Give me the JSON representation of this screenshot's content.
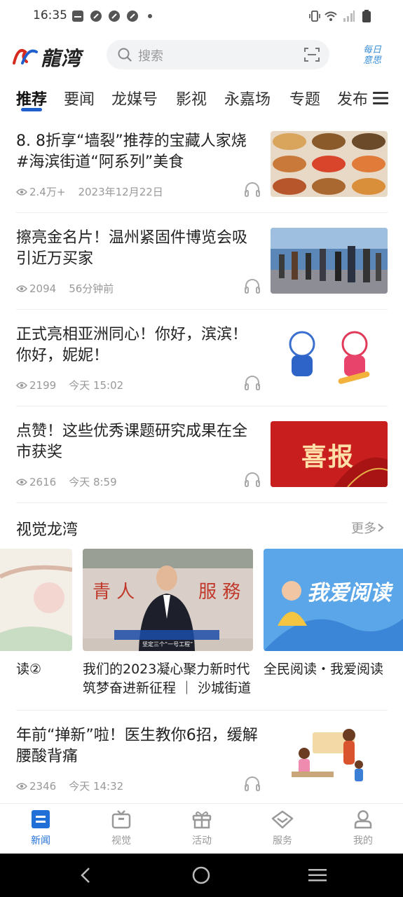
{
  "status_bar": {
    "time": "16:35"
  },
  "header": {
    "logo_text": "龍湾",
    "search_placeholder": "搜索",
    "daily_brief_line1": "每日",
    "daily_brief_line2": "意思"
  },
  "tabs": [
    {
      "label": "推荐"
    },
    {
      "label": "要闻"
    },
    {
      "label": "龙媒号"
    },
    {
      "label": "影视"
    },
    {
      "label": "永嘉场"
    },
    {
      "label": "专题"
    },
    {
      "label": "发布"
    }
  ],
  "news": [
    {
      "title": "8. 8折享“墙裂”推荐的宝藏人家烧　#海滨街道“阿系列”美食",
      "views": "2.4万+",
      "time": "2023年12月22日"
    },
    {
      "title": "擦亮金名片！温州紧固件博览会吸引近万买家",
      "views": "2094",
      "time": "56分钟前"
    },
    {
      "title": "正式亮相亚洲同心！你好，滨滨！你好，妮妮！",
      "views": "2199",
      "time": "今天  15:02"
    },
    {
      "title": "点赞！这些优秀课题研究成果在全市获奖",
      "views": "2616",
      "time": "今天  8:59",
      "thumb_text": "喜报"
    },
    {
      "title": "年前“掸新”啦！医生教你6招，缓解腰酸背痛",
      "views": "2346",
      "time": "今天  14:32"
    }
  ],
  "visual_section": {
    "title": "视觉龙湾",
    "more": "更多",
    "cards": [
      {
        "title": "读②"
      },
      {
        "title_line1": "我们的2023凝心聚力新时代",
        "title_line2": "筑梦奋进新征程 ｜ 沙城街道",
        "caption": "坚定三个“一号工程”"
      },
      {
        "title": "全民阅读・我爱阅读",
        "image_text": "我爱阅读"
      }
    ]
  },
  "bottom_nav": [
    {
      "label": "新闻",
      "icon": "news-icon",
      "active": true
    },
    {
      "label": "视觉",
      "icon": "tv-icon"
    },
    {
      "label": "活动",
      "icon": "gift-icon"
    },
    {
      "label": "服务",
      "icon": "service-icon"
    },
    {
      "label": "我的",
      "icon": "user-icon"
    }
  ],
  "colors": {
    "accent": "#1f5fce",
    "active_nav": "#1f6fd6",
    "meta_gray": "#999999",
    "thumb_red": "#c81e1e"
  }
}
